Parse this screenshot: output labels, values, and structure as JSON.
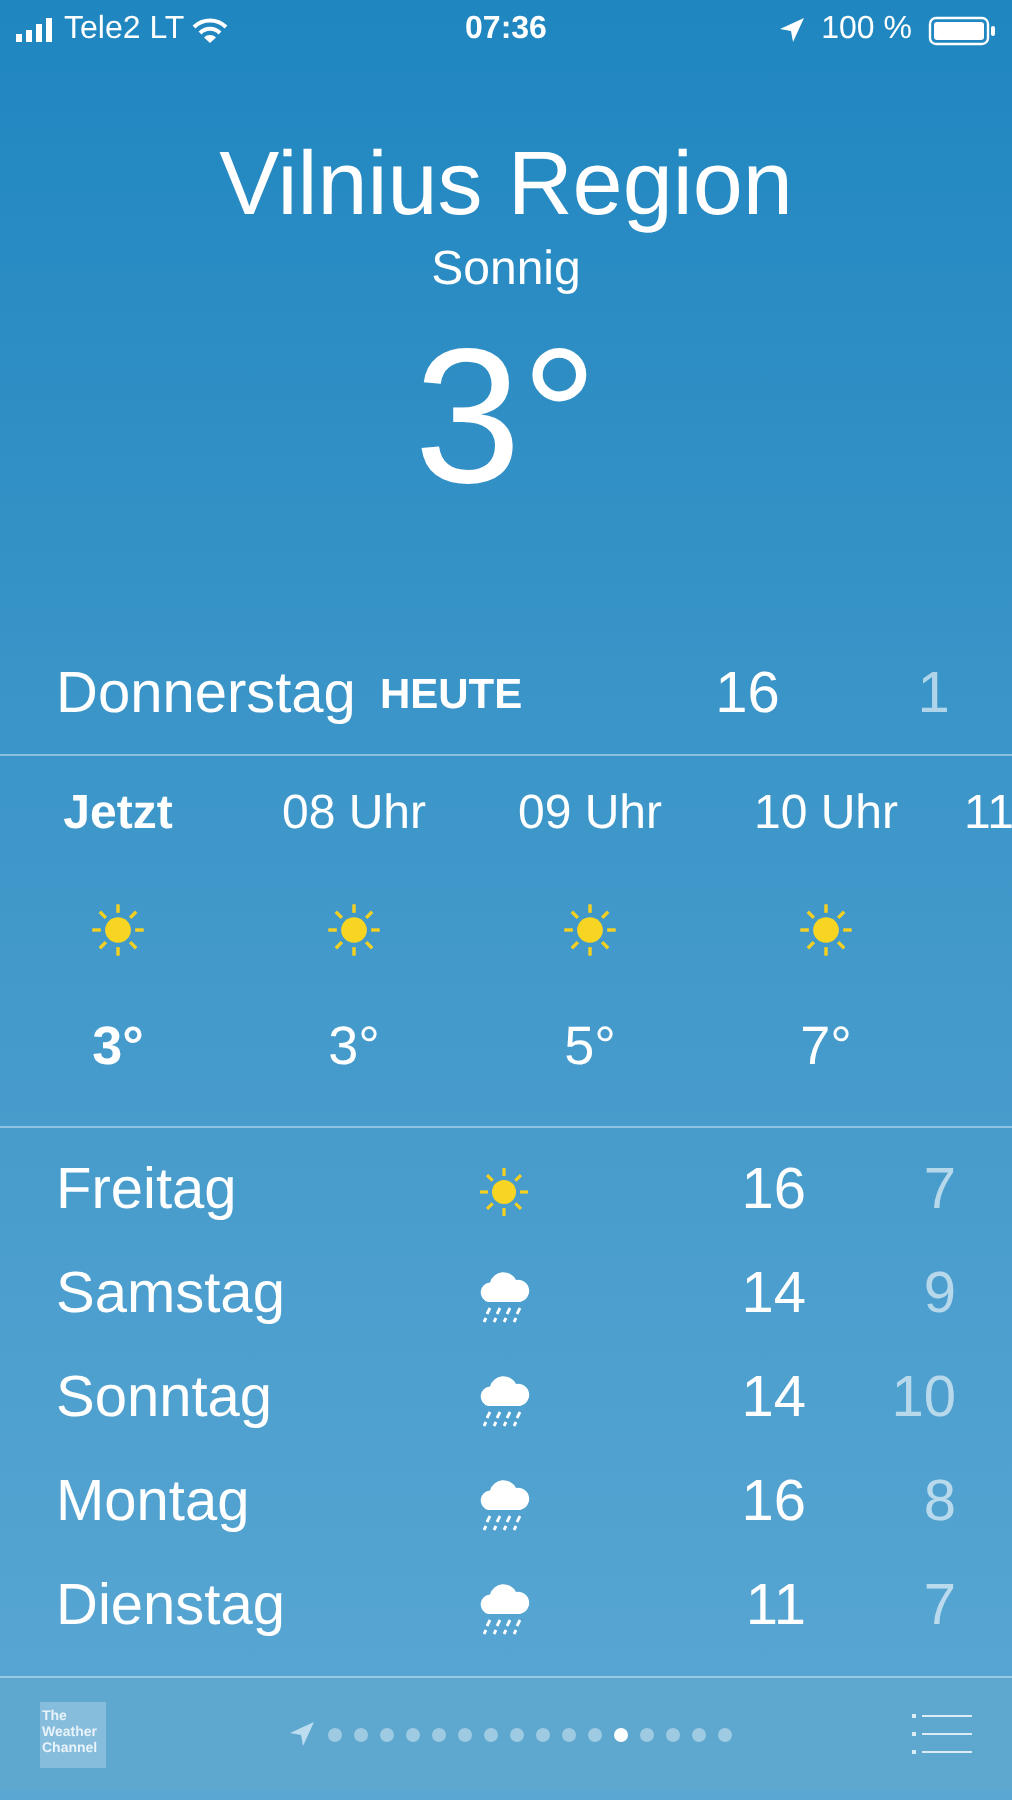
{
  "status_bar": {
    "carrier": "Tele2 LT",
    "time": "07:36",
    "battery": "100 %"
  },
  "location": {
    "city": "Vilnius Region",
    "condition": "Sonnig",
    "temperature": "3°"
  },
  "today": {
    "day": "Donnerstag",
    "label": "HEUTE",
    "high": "16",
    "low": "1"
  },
  "hourly": [
    {
      "time": "Jetzt",
      "kind": "sun",
      "temp": "3°",
      "current": true
    },
    {
      "time": "08 Uhr",
      "kind": "sun",
      "temp": "3°",
      "current": false
    },
    {
      "time": "09 Uhr",
      "kind": "sun",
      "temp": "5°",
      "current": false
    },
    {
      "time": "10 Uhr",
      "kind": "sun",
      "temp": "7°",
      "current": false
    },
    {
      "time": "11",
      "kind": "partial",
      "current": false
    }
  ],
  "daily": [
    {
      "day": "Freitag",
      "kind": "sun",
      "high": "16",
      "low": "7"
    },
    {
      "day": "Samstag",
      "kind": "rain",
      "high": "14",
      "low": "9"
    },
    {
      "day": "Sonntag",
      "kind": "rain",
      "high": "14",
      "low": "10"
    },
    {
      "day": "Montag",
      "kind": "rain",
      "high": "16",
      "low": "8"
    },
    {
      "day": "Dienstag",
      "kind": "rain",
      "high": "11",
      "low": "7"
    }
  ],
  "bottom_bar": {
    "logo": "The Weather Channel",
    "pages": [
      {
        "selected": false
      },
      {
        "selected": false
      },
      {
        "selected": false
      },
      {
        "selected": false
      },
      {
        "selected": false
      },
      {
        "selected": false
      },
      {
        "selected": false
      },
      {
        "selected": false
      },
      {
        "selected": false
      },
      {
        "selected": false
      },
      {
        "selected": false
      },
      {
        "selected": true
      },
      {
        "selected": false
      },
      {
        "selected": false
      },
      {
        "selected": false
      },
      {
        "selected": false
      }
    ]
  }
}
